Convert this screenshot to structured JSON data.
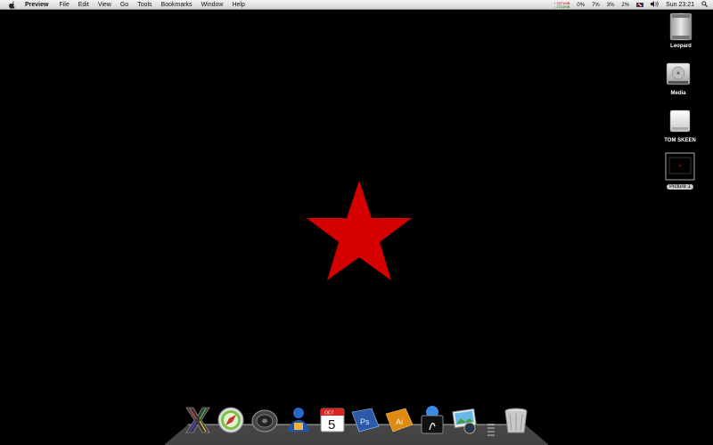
{
  "menubar": {
    "app_name": "Preview",
    "items": [
      "File",
      "Edit",
      "View",
      "Go",
      "Tools",
      "Bookmarks",
      "Window",
      "Help"
    ],
    "status": {
      "net_up": "↑ 2371MB",
      "net_down": "↓ 2722MB",
      "cpu_values": [
        "0%",
        "7%",
        "3%",
        "2%"
      ],
      "clock": "Sun 23:21"
    }
  },
  "desktop": {
    "icons": [
      {
        "label": "Leopard",
        "icon": "mac-pro-icon"
      },
      {
        "label": "Media",
        "icon": "hard-drive-icon"
      },
      {
        "label": "TOM SKEEN",
        "icon": "usb-drive-icon"
      },
      {
        "label": "Picture 1",
        "icon": "image-thumbnail-icon"
      }
    ],
    "star_color": "#d40000"
  },
  "dock": {
    "items": [
      {
        "name": "mac-os-x-icon"
      },
      {
        "name": "safari-icon"
      },
      {
        "name": "speaker-icon"
      },
      {
        "name": "user-icon"
      },
      {
        "name": "ical-icon",
        "month": "OCT",
        "day": "5"
      },
      {
        "name": "photoshop-icon",
        "text": "Ps"
      },
      {
        "name": "illustrator-icon",
        "text": "Ai"
      },
      {
        "name": "acrobat-icon"
      },
      {
        "name": "iphoto-icon"
      },
      {
        "name": "trash-icon"
      }
    ]
  }
}
